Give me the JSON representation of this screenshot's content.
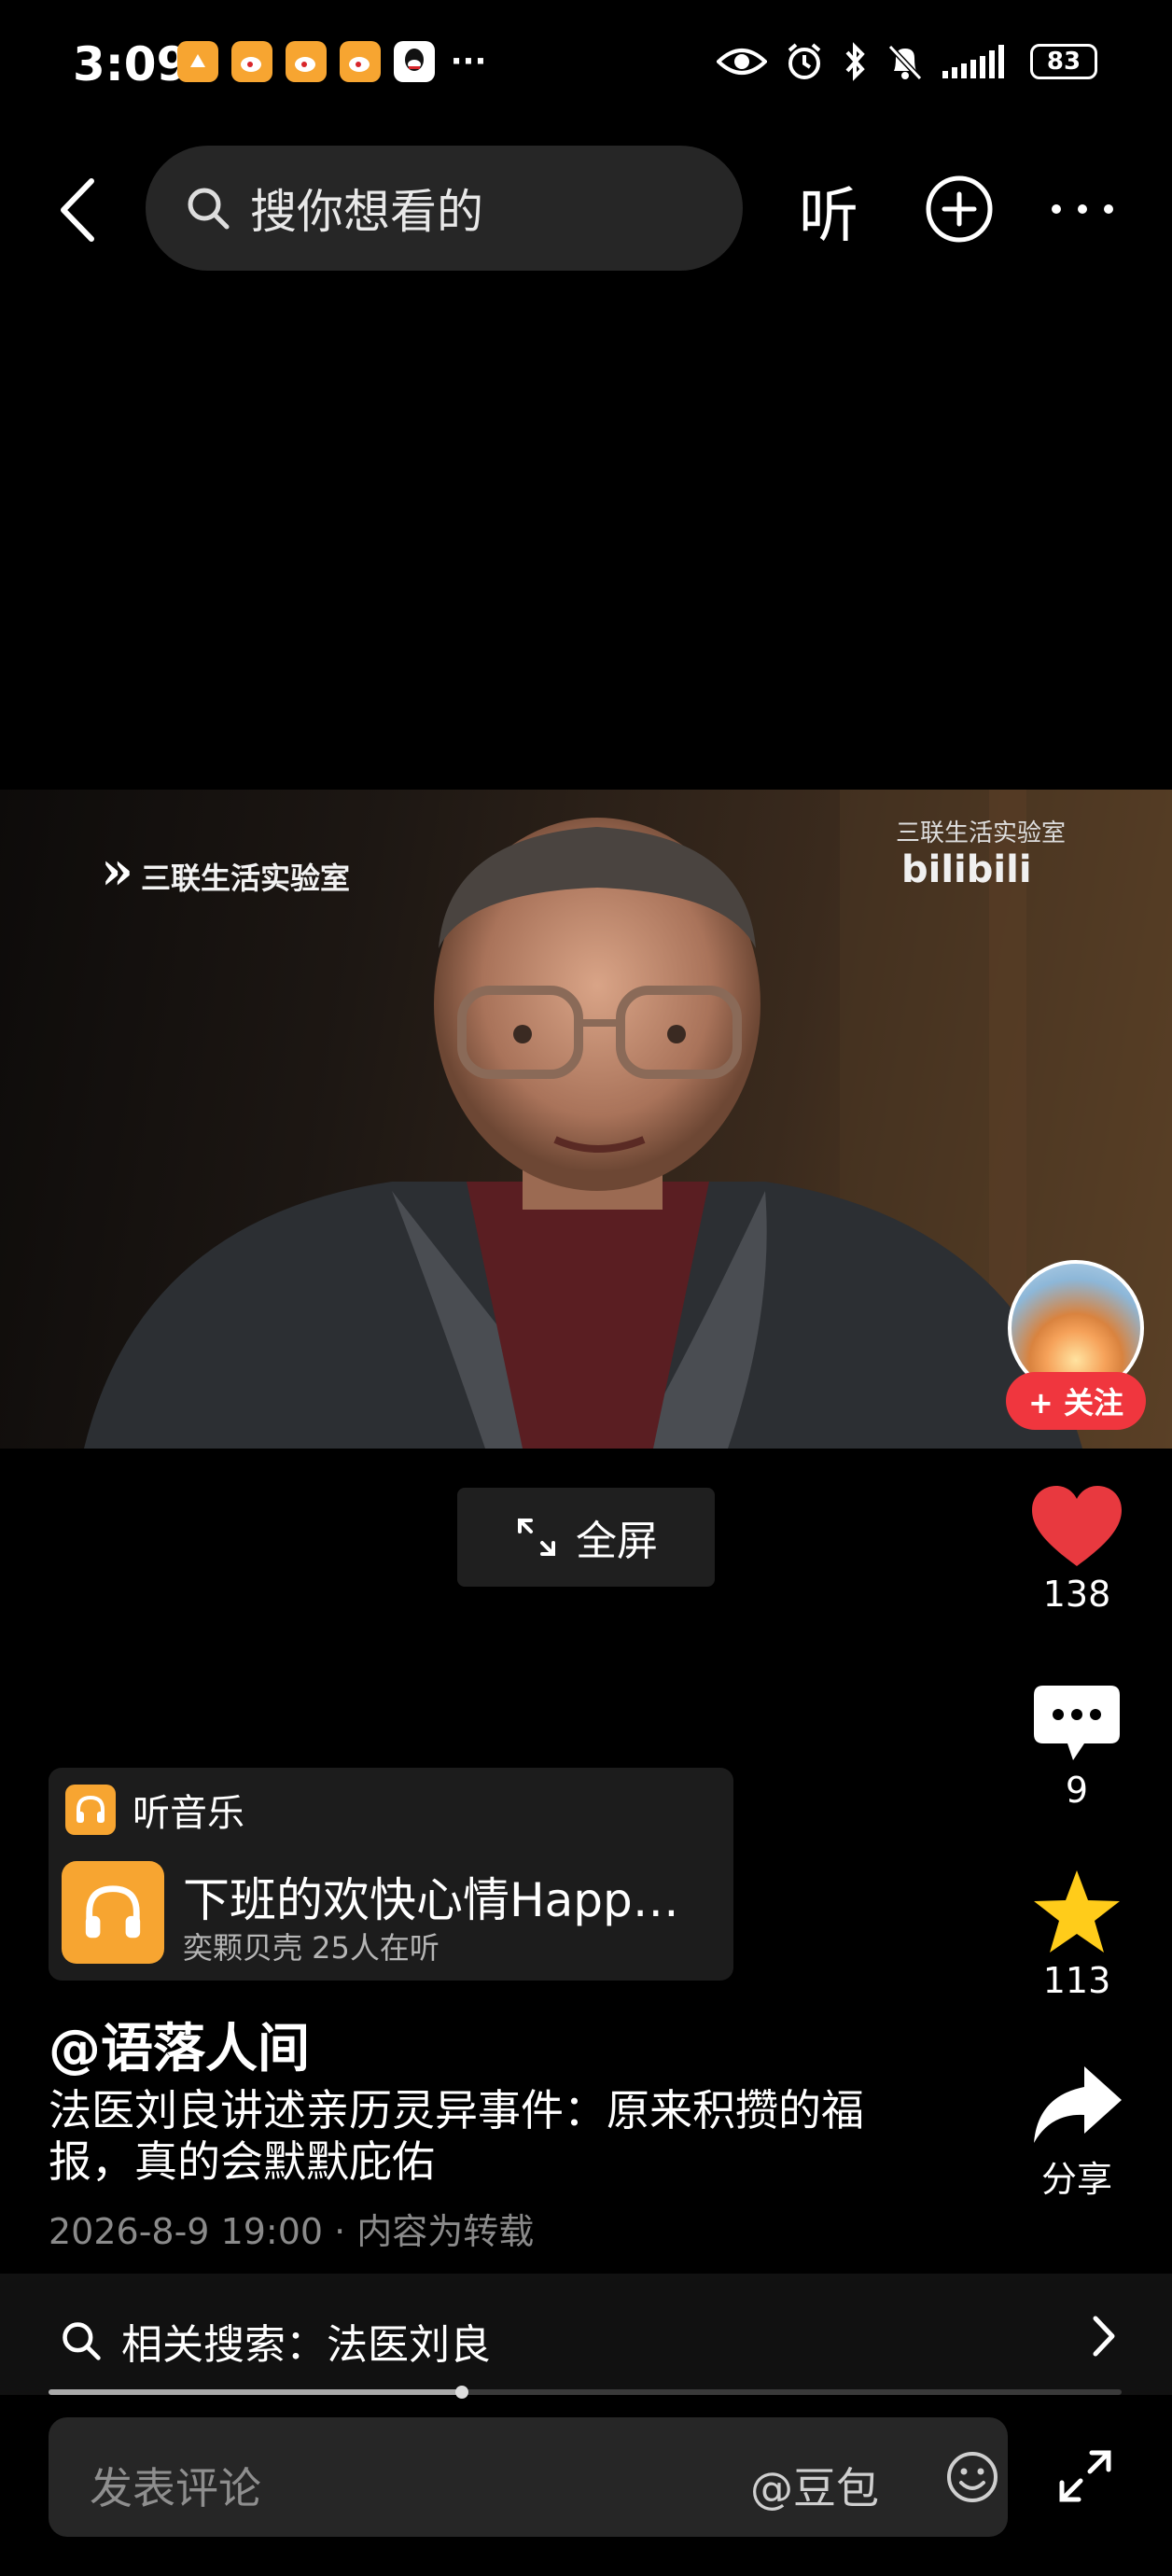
{
  "status_bar": {
    "time": "3:09",
    "battery": "83",
    "notification_icons": [
      "app-icon",
      "weibo-icon",
      "weibo-icon",
      "weibo-icon",
      "qq-icon"
    ],
    "more": "···"
  },
  "top_nav": {
    "search_placeholder": "搜你想看的",
    "listen_label": "听"
  },
  "video": {
    "logo_left": "三联生活实验室",
    "logo_right": "三联生活实验室",
    "logo_right_brand": "bilibili"
  },
  "author_follow": {
    "follow_label": "+ 关注"
  },
  "fullscreen": {
    "label": "全屏"
  },
  "actions": {
    "likes": "138",
    "comments": "9",
    "favorites": "113",
    "share_label": "分享",
    "like_color": "#e8393f",
    "favorite_color": "#ffcc1a"
  },
  "music": {
    "header": "听音乐",
    "title": "下班的欢快心情Happ…",
    "subtitle": "奕颗贝壳 25人在听",
    "accent": "#f7a531"
  },
  "post": {
    "author": "@语落人间",
    "caption": "法医刘良讲述亲历灵异事件：原来积攒的福报，真的会默默庇佑",
    "meta": "2026-8-9 19:00 · 内容为转载"
  },
  "related_search": {
    "label": "相关搜索：",
    "query": "法医刘良"
  },
  "progress": {
    "fraction": 0.385
  },
  "bottom_bar": {
    "comment_placeholder": "发表评论",
    "mention": "@豆包"
  }
}
